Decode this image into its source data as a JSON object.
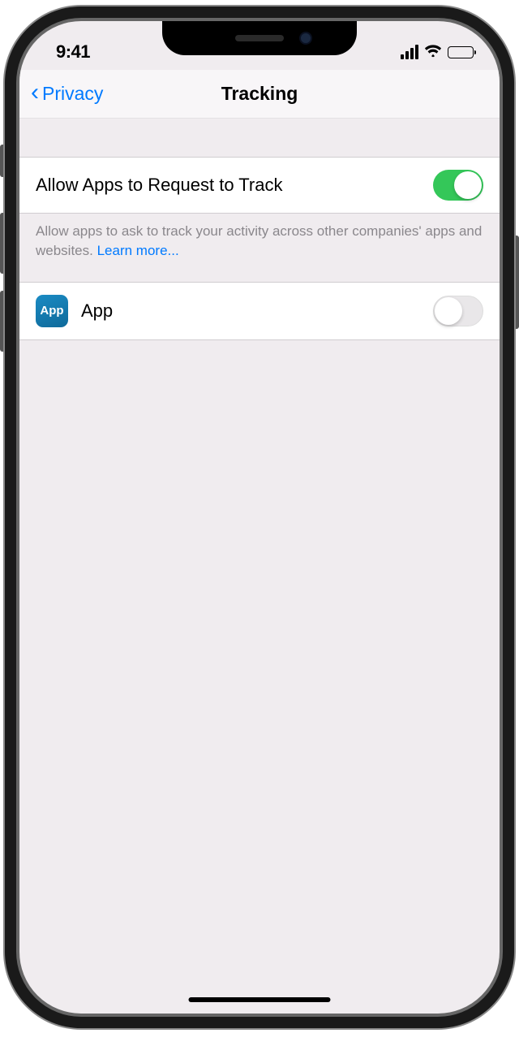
{
  "status": {
    "time": "9:41"
  },
  "nav": {
    "back_label": "Privacy",
    "title": "Tracking"
  },
  "main_toggle": {
    "label": "Allow Apps to Request to Track",
    "on": true
  },
  "footer": {
    "text": "Allow apps to ask to track your activity across other companies' apps and websites. ",
    "link": "Learn more..."
  },
  "apps": [
    {
      "icon_text": "App",
      "name": "App",
      "on": false
    }
  ]
}
